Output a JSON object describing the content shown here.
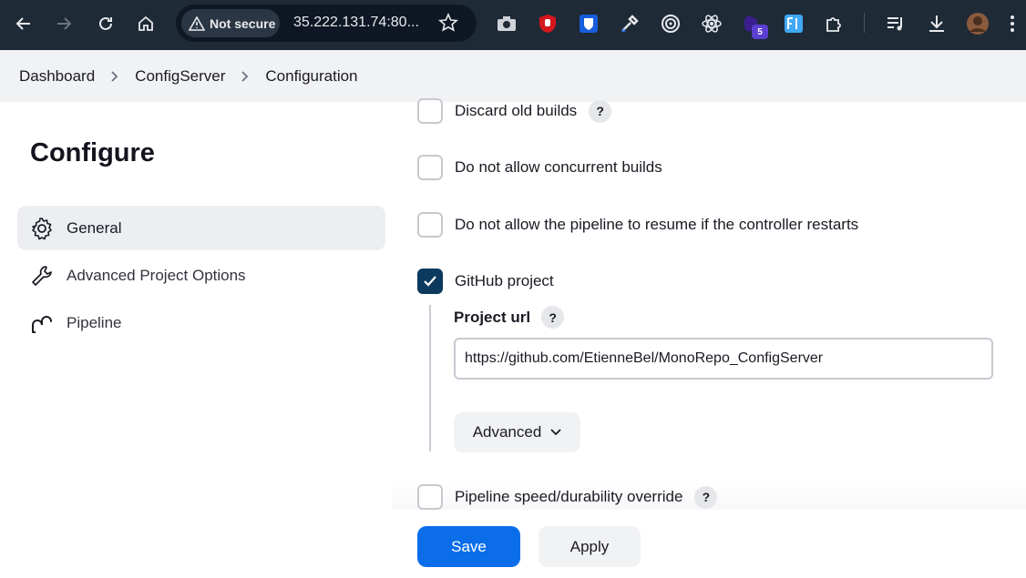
{
  "browser": {
    "back_icon": "arrow-left-icon",
    "forward_icon": "arrow-right-icon",
    "reload_icon": "reload-icon",
    "home_icon": "home-icon",
    "security_label": "Not secure",
    "url": "35.222.131.74:80...",
    "extension_badge": "5"
  },
  "breadcrumb": {
    "items": [
      "Dashboard",
      "ConfigServer",
      "Configuration"
    ]
  },
  "sidebar": {
    "title": "Configure",
    "items": [
      {
        "label": "General",
        "icon": "gear-icon",
        "active": true
      },
      {
        "label": "Advanced Project Options",
        "icon": "wrench-icon",
        "active": false
      },
      {
        "label": "Pipeline",
        "icon": "pipeline-icon",
        "active": false
      }
    ]
  },
  "form": {
    "options": [
      {
        "label": "Discard old builds",
        "checked": false,
        "help": "?"
      },
      {
        "label": "Do not allow concurrent builds",
        "checked": false
      },
      {
        "label": "Do not allow the pipeline to resume if the controller restarts",
        "checked": false
      },
      {
        "label": "GitHub project",
        "checked": true
      },
      {
        "label": "Pipeline speed/durability override",
        "checked": false,
        "help": "?"
      }
    ],
    "project_url": {
      "label": "Project url",
      "help": "?",
      "value": "https://github.com/EtienneBel/MonoRepo_ConfigServer"
    },
    "advanced_label": "Advanced"
  },
  "footer": {
    "save_label": "Save",
    "apply_label": "Apply"
  },
  "colors": {
    "chrome_bg": "#1f2a37",
    "primary": "#0b6ee8",
    "checkbox_checked": "#0b3a5e"
  }
}
